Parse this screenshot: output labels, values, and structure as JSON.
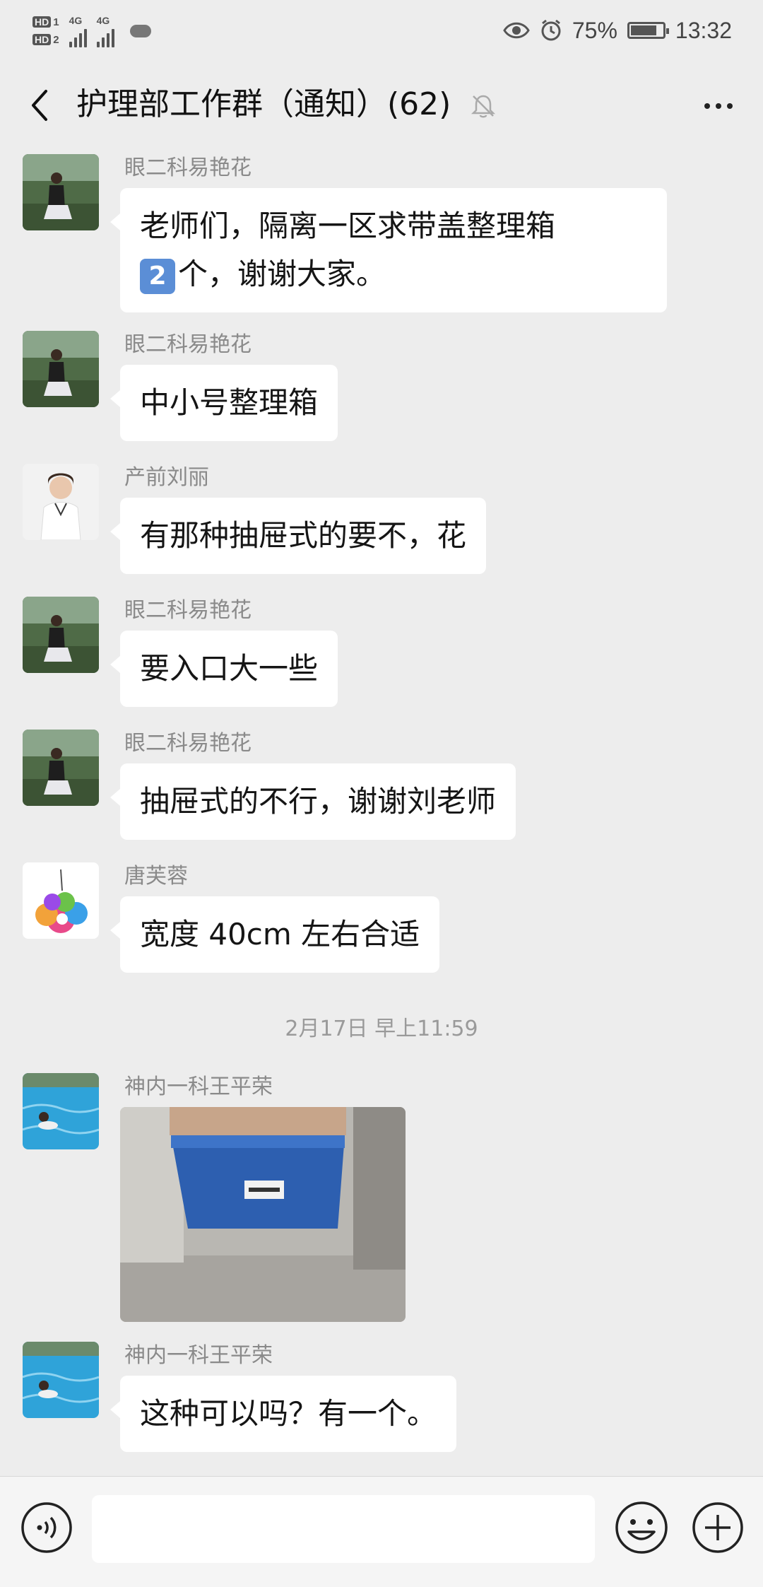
{
  "status_bar": {
    "hd1": "HD",
    "hd1_sub": "1",
    "hd2": "HD",
    "hd2_sub": "2",
    "net1": "4G",
    "net2": "4G",
    "battery_pct": "75%",
    "battery_level": 0.75,
    "time": "13:32",
    "icons": [
      "eye-icon",
      "alarm-icon",
      "battery-icon",
      "signal-icon",
      "cloud-icon"
    ]
  },
  "header": {
    "title": "护理部工作群（通知）(62)",
    "back_icon": "chevron-left-icon",
    "mute_icon": "bell-muted-icon",
    "more_icon": "more-icon"
  },
  "messages": [
    {
      "sender": "眼二科易艳花",
      "text": "个，谢谢大家。",
      "text_prefix": "老师们，隔离一区求带盖整理箱",
      "keycap": "2"
    },
    {
      "sender": "眼二科易艳花",
      "text": "中小号整理箱"
    },
    {
      "sender": "产前刘丽",
      "text": "有那种抽屉式的要不，花"
    },
    {
      "sender": "眼二科易艳花",
      "text": "要入口大一些"
    },
    {
      "sender": "眼二科易艳花",
      "text": "抽屉式的不行，谢谢刘老师"
    },
    {
      "sender": "唐芙蓉",
      "text": "宽度 40cm 左右合适"
    },
    {
      "sender": "神内一科王平荣",
      "image": "photo-blue-storage-box"
    },
    {
      "sender": "神内一科王平荣",
      "text": "这种可以吗？有一个。"
    }
  ],
  "timestamp": "2月17日 早上11:59",
  "input_bar": {
    "voice_icon": "voice-icon",
    "emoji_icon": "emoji-icon",
    "plus_icon": "plus-icon",
    "value": ""
  }
}
